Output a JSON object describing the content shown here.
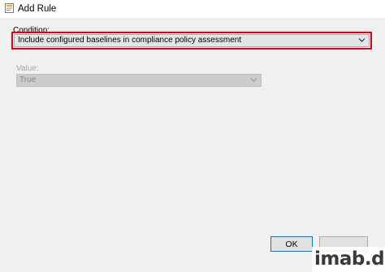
{
  "window": {
    "title": "Add Rule",
    "icon": "app-form-icon"
  },
  "condition": {
    "label": "Condition:",
    "selected": "Include configured baselines in compliance policy assessment",
    "highlight_color": "#e0001b"
  },
  "value": {
    "label": "Value:",
    "selected": "True",
    "enabled": false
  },
  "buttons": {
    "ok": "OK"
  },
  "watermark": "imab.dk"
}
